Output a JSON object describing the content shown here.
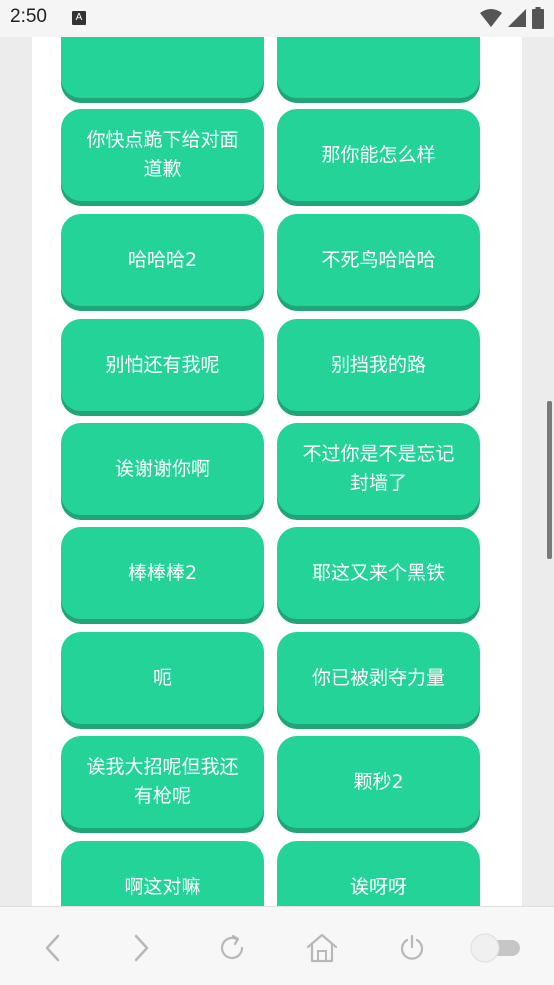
{
  "status_bar": {
    "time": "2:50",
    "notification_icon": "a-letter-icon",
    "notification_glyph": "A",
    "wifi_icon": "wifi-icon",
    "signal_icon": "signal-icon",
    "battery_icon": "battery-icon"
  },
  "buttons": [
    {
      "label": ""
    },
    {
      "label": ""
    },
    {
      "label": "你快点跪下给对面道歉"
    },
    {
      "label": "那你能怎么样"
    },
    {
      "label": "哈哈哈2"
    },
    {
      "label": "不死鸟哈哈哈"
    },
    {
      "label": "别怕还有我呢"
    },
    {
      "label": "别挡我的路"
    },
    {
      "label": "诶谢谢你啊"
    },
    {
      "label": "不过你是不是忘记封墙了"
    },
    {
      "label": "棒棒棒2"
    },
    {
      "label": "耶这又来个黑铁"
    },
    {
      "label": "呃"
    },
    {
      "label": "你已被剥夺力量"
    },
    {
      "label": "诶我大招呢但我还有枪呢"
    },
    {
      "label": "颗秒2"
    },
    {
      "label": "啊这对嘛"
    },
    {
      "label": "诶呀呀"
    }
  ],
  "bottom_nav": {
    "back_icon": "chevron-left-icon",
    "forward_icon": "chevron-right-icon",
    "refresh_icon": "refresh-icon",
    "home_icon": "home-icon",
    "power_icon": "power-icon",
    "toggle_icon": "toggle-switch-icon",
    "toggle_on": false
  },
  "colors": {
    "button_bg": "#24d397",
    "button_shadow": "#1fa578",
    "button_text": "#ffffff",
    "panel_bg": "#ffffff",
    "page_bg": "#ececec",
    "icon_gray": "#b8b8b8"
  }
}
